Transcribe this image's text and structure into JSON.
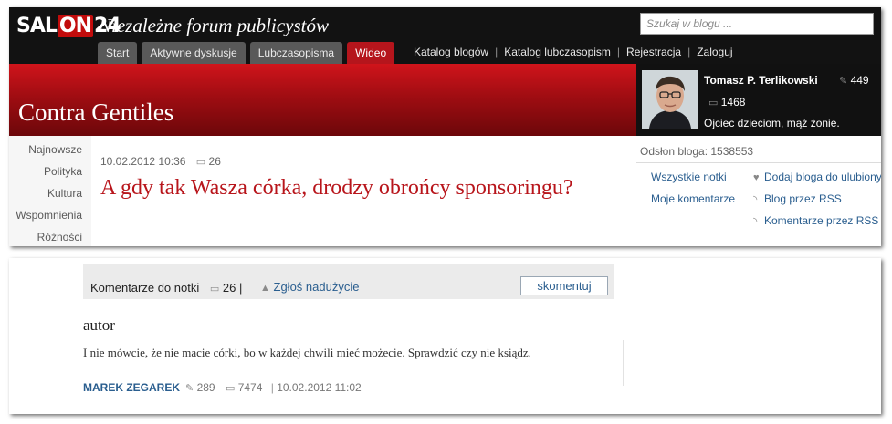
{
  "header": {
    "logo": {
      "left": "SAL",
      "mid": "ON",
      "right": "24"
    },
    "tagline": "Niezależne forum publicystów",
    "search_placeholder": "Szukaj w blogu ...",
    "tabs": [
      {
        "label": "Start",
        "active": false
      },
      {
        "label": "Aktywne dyskusje",
        "active": false
      },
      {
        "label": "Lubczasopisma",
        "active": false
      },
      {
        "label": "Wideo",
        "active": true
      }
    ],
    "links": [
      "Katalog blogów",
      "Katalog lubczasopism",
      "Rejestracja",
      "Zaloguj"
    ]
  },
  "blog": {
    "title": "Contra Gentiles",
    "author": {
      "name": "Tomasz P. Terlikowski",
      "posts": "449",
      "comments": "1468",
      "motto": "Ojciec dzieciom, mąż żonie."
    },
    "categories": [
      "Najnowsze",
      "Polityka",
      "Kultura",
      "Wspomnienia",
      "Różności"
    ]
  },
  "post": {
    "datetime": "10.02.2012 10:36",
    "comments": "26",
    "title": "A gdy tak Wasza córka, drodzy obrońcy sponsoringu?"
  },
  "sidebar_right": {
    "views_label": "Odsłon bloga: 1538553",
    "links_left": [
      "Wszystkie notki",
      "Moje komentarze"
    ],
    "links_right": [
      "Dodaj bloga do ulubionych",
      "Blog przez RSS",
      "Komentarze przez RSS"
    ]
  },
  "comments": {
    "label": "Komentarze do notki",
    "count": "26",
    "separator": "|",
    "report_label": "Zgłoś nadużycie",
    "comment_button": "skomentuj",
    "item": {
      "title": "autor",
      "body": "I nie mówcie, że nie macie córki, bo w każdej chwili mieć możecie. Sprawdzić czy nie ksiądz.",
      "author": "MAREK ZEGAREK",
      "posts": "289",
      "comments": "7474",
      "datetime": "10.02.2012 11:02"
    }
  },
  "colors": {
    "brand_red": "#b8151b",
    "link_blue": "#2a5e8f",
    "topbar": "#121212"
  }
}
